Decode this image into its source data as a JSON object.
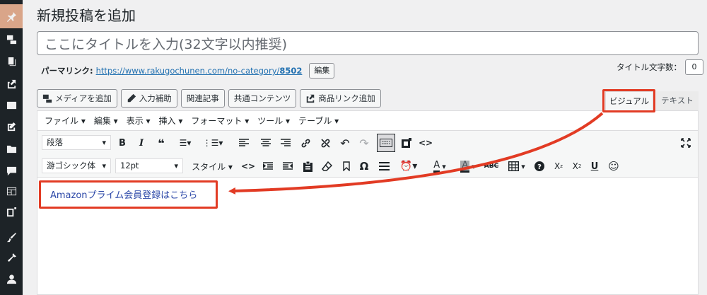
{
  "page": {
    "title": "新規投稿を追加",
    "title_placeholder": "ここにタイトルを入力(32文字以内推奨)"
  },
  "permalink": {
    "label": "パーマリンク:",
    "url_base": "https://www.rakugochunen.com/no-category/",
    "slug": "8502",
    "edit_label": "編集"
  },
  "counter": {
    "label": "タイトル文字数：",
    "value": "0"
  },
  "media_buttons": [
    {
      "label": "メディアを追加",
      "icon": "media-icon"
    },
    {
      "label": "入力補助",
      "icon": "pencil-icon"
    },
    {
      "label": "関連記事"
    },
    {
      "label": "共通コンテンツ"
    },
    {
      "label": "商品リンク追加",
      "icon": "external-link-icon"
    }
  ],
  "tabs": {
    "visual": "ビジュアル",
    "text": "テキスト"
  },
  "menubar": [
    "ファイル ▾",
    "編集 ▾",
    "表示 ▾",
    "挿入 ▾",
    "フォーマット ▾",
    "ツール ▾",
    "テーブル ▾"
  ],
  "toolbar": {
    "format_select": "段落",
    "font_select": "游ゴシック体",
    "size_select": "12pt",
    "style_label": "スタイル ▾"
  },
  "content": {
    "link_text": "Amazonプライム会員登録はこちら"
  },
  "colors": {
    "highlight": "#e23b24",
    "link": "#2c48a8",
    "sidebar": "#1d2327",
    "active_menu": "#d9a589"
  }
}
